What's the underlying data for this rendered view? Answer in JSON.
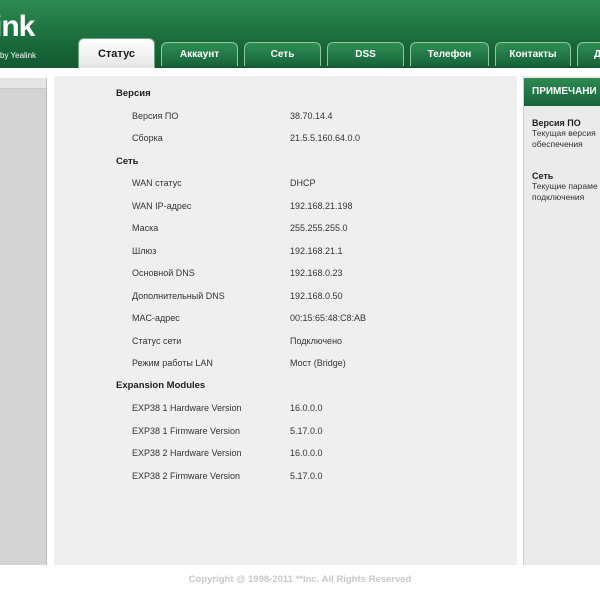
{
  "header": {
    "logo": "ink",
    "tagline": "by Yealink"
  },
  "tabs": [
    {
      "label": "Статус",
      "active": true
    },
    {
      "label": "Аккаунт"
    },
    {
      "label": "Сеть"
    },
    {
      "label": "DSS"
    },
    {
      "label": "Телефон"
    },
    {
      "label": "Контакты"
    },
    {
      "label": "Д"
    }
  ],
  "sections": {
    "version": {
      "title": "Версия",
      "rows": [
        {
          "label": "Версия ПО",
          "value": "38.70.14.4"
        },
        {
          "label": "Сборка",
          "value": "21.5.5.160.64.0.0"
        }
      ]
    },
    "network": {
      "title": "Сеть",
      "rows": [
        {
          "label": "WAN статус",
          "value": "DHCP"
        },
        {
          "label": "WAN IP-адрес",
          "value": "192.168.21.198"
        },
        {
          "label": "Маска",
          "value": "255.255.255.0"
        },
        {
          "label": "Шлюз",
          "value": "192.168.21.1"
        },
        {
          "label": "Основной DNS",
          "value": "192.168.0.23"
        },
        {
          "label": "Дополнительный DNS",
          "value": "192.168.0.50"
        },
        {
          "label": "MAC-адрес",
          "value": "00:15:65:48:C8:AB"
        },
        {
          "label": "Статус сети",
          "value": "Подключено"
        },
        {
          "label": "Режим работы LAN",
          "value": "Мост (Bridge)"
        }
      ]
    },
    "expansion": {
      "title": "Expansion Modules",
      "rows": [
        {
          "label": "EXP38 1 Hardware Version",
          "value": "16.0.0.0"
        },
        {
          "label": "EXP38 1 Firmware Version",
          "value": "5.17.0.0"
        },
        {
          "label": "EXP38 2 Hardware Version",
          "value": "16.0.0.0"
        },
        {
          "label": "EXP38 2 Firmware Version",
          "value": "5.17.0.0"
        }
      ]
    }
  },
  "notes": {
    "header": "ПРИМЕЧАНИ",
    "items": [
      {
        "title": "Версия ПО",
        "line1": "Текущая версия",
        "line2": "обеспечения"
      },
      {
        "title": "Сеть",
        "line1": "Текущие параме",
        "line2": "подключения"
      }
    ]
  },
  "footer": {
    "copyright": "Copyright @ 1998-2011 **Inc. All Rights Reserved"
  },
  "colors": {
    "brand_green": "#1a6b3b",
    "content_bg": "#efefef",
    "footer_text": "#c8c8c8"
  }
}
